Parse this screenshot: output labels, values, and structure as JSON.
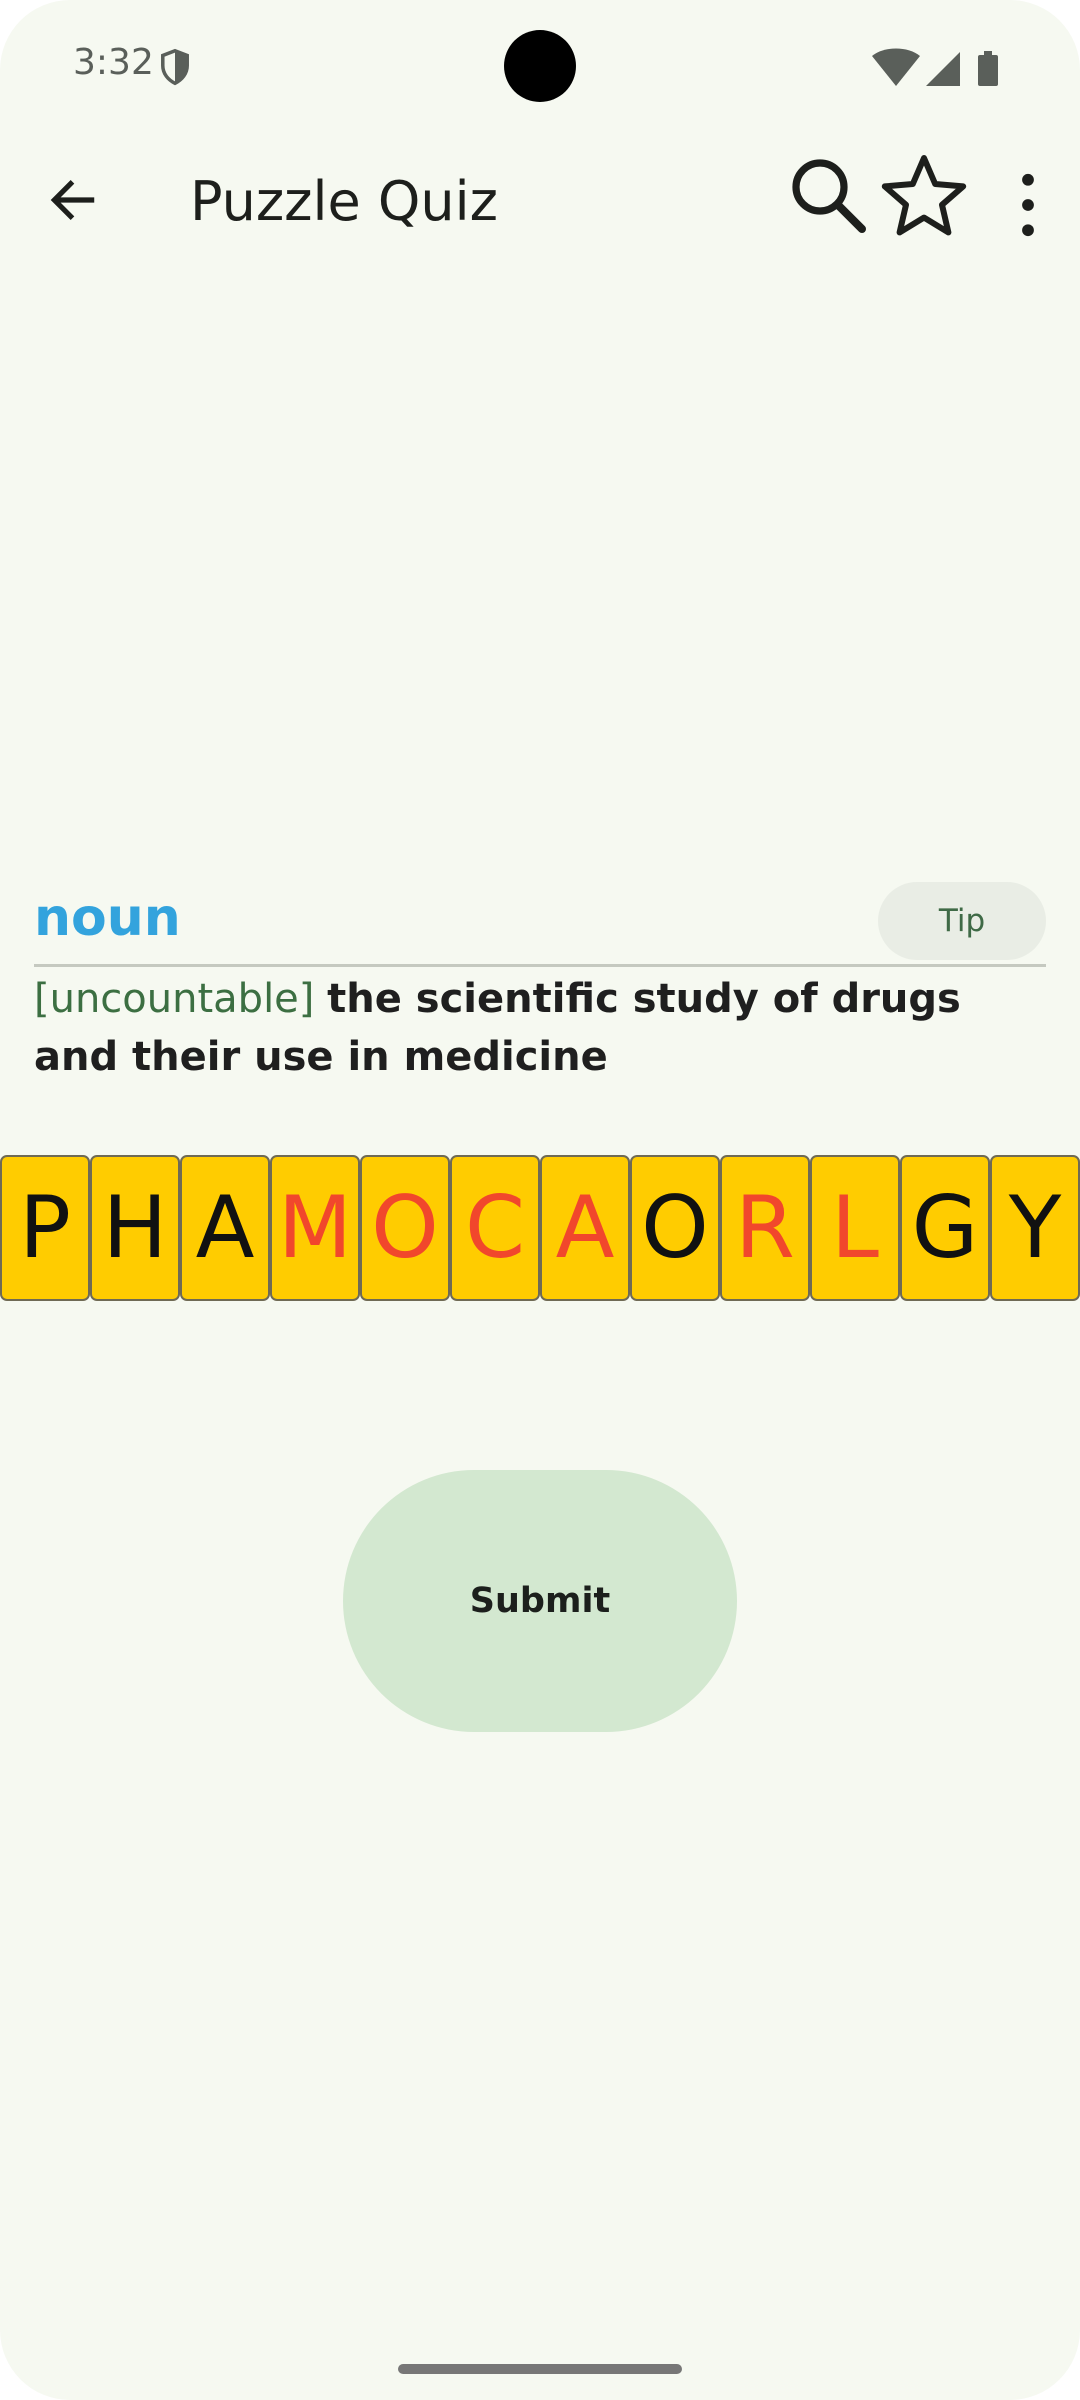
{
  "status_bar": {
    "time": "3:32",
    "icons": [
      "shield-icon",
      "wifi-icon",
      "signal-icon",
      "battery-icon"
    ]
  },
  "app_bar": {
    "title": "Puzzle Quiz",
    "icons": [
      "back-arrow-icon",
      "search-icon",
      "star-outline-icon",
      "more-vert-icon"
    ]
  },
  "definition": {
    "part_of_speech": "noun",
    "tip_label": "Tip",
    "tag": "[uncountable]",
    "text": "the scientific study of drugs and their use in medicine"
  },
  "tiles": [
    {
      "letter": "P",
      "color": "#111111"
    },
    {
      "letter": "H",
      "color": "#111111"
    },
    {
      "letter": "A",
      "color": "#111111"
    },
    {
      "letter": "M",
      "color": "#f1472c"
    },
    {
      "letter": "O",
      "color": "#f1472c"
    },
    {
      "letter": "C",
      "color": "#f1472c"
    },
    {
      "letter": "A",
      "color": "#f1472c"
    },
    {
      "letter": "O",
      "color": "#111111"
    },
    {
      "letter": "R",
      "color": "#f1472c"
    },
    {
      "letter": "L",
      "color": "#f1472c"
    },
    {
      "letter": "G",
      "color": "#111111"
    },
    {
      "letter": "Y",
      "color": "#111111"
    }
  ],
  "actions": {
    "submit_label": "Submit"
  },
  "colors": {
    "background": "#f6f9f1",
    "part_of_speech": "#33a3dd",
    "tile_background": "#ffcc00",
    "submit_background": "#d3e8d0"
  }
}
